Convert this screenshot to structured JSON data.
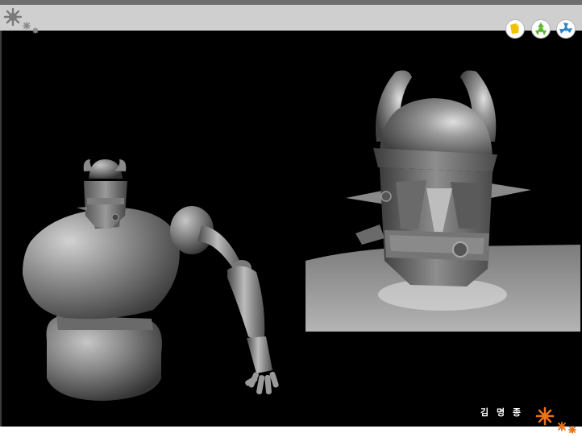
{
  "header": {
    "logo_icon": "flower-gear-icon",
    "background_color": "#cfcfcf",
    "top_strip_color": "#6e6e6e"
  },
  "nav": {
    "buttons": [
      {
        "icon": "folder-icon",
        "color": "#f2c200"
      },
      {
        "icon": "recycle-icon",
        "color": "#5cb82e"
      },
      {
        "icon": "fan-icon",
        "color": "#2e86c8"
      }
    ]
  },
  "content": {
    "background_color": "#000000",
    "left_render_subject": "robot-figure",
    "right_render_subject": "robot-head-closeup",
    "model_color": "#8a8a8a"
  },
  "footer": {
    "author": "김 명 종",
    "decoration_icon": "orange-flower-icon",
    "decoration_color": "#e8731a"
  }
}
